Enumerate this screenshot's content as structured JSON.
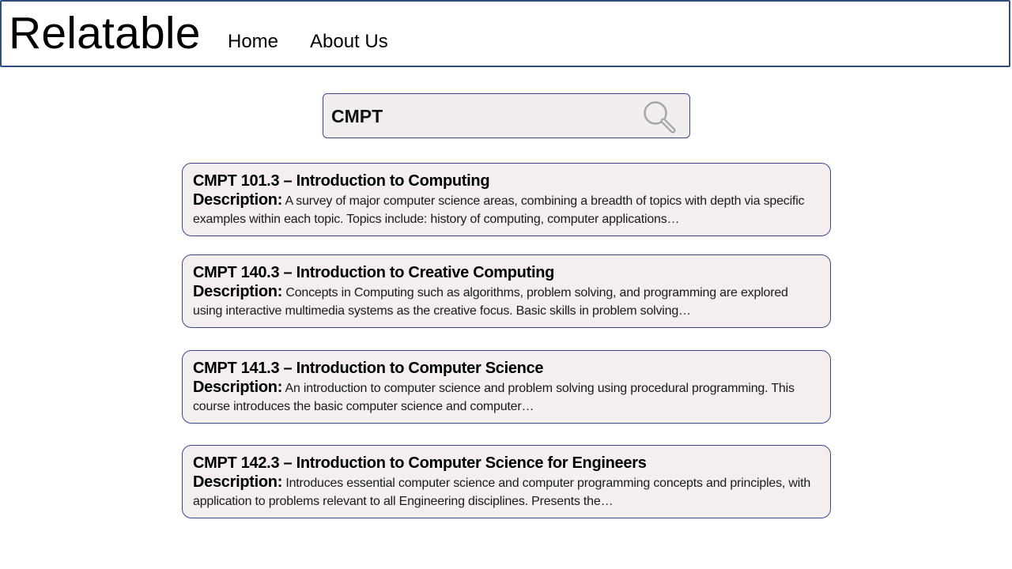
{
  "header": {
    "brand": "Relatable",
    "nav": [
      {
        "label": "Home"
      },
      {
        "label": "About Us"
      }
    ]
  },
  "search": {
    "value": "CMPT",
    "placeholder": ""
  },
  "icons": {
    "search": "search-icon"
  },
  "colors": {
    "border_accent": "#3a4a86",
    "header_border": "#2f4f7f",
    "card_background": "#f4eeee"
  },
  "results": [
    {
      "title": "CMPT 101.3 – Introduction to Computing",
      "description_label": "Description:",
      "description": "A survey of major computer science areas, combining a breadth of topics with depth via specific examples within each topic. Topics include: history of computing, computer applications…"
    },
    {
      "title": "CMPT 140.3 – Introduction to Creative Computing",
      "description_label": "Description:",
      "description": "Concepts in Computing such as algorithms, problem solving, and programming are explored using interactive multimedia systems as the creative focus. Basic skills in problem solving…"
    },
    {
      "title": "CMPT 141.3 – Introduction to Computer Science",
      "description_label": "Description:",
      "description": "An introduction to computer science and problem solving using procedural programming. This course introduces the basic computer science and computer…"
    },
    {
      "title": "CMPT 142.3 – Introduction to Computer Science for Engineers",
      "description_label": "Description:",
      "description": "Introduces essential computer science and computer programming concepts and principles, with application to problems relevant to all Engineering disciplines. Presents the…"
    }
  ]
}
